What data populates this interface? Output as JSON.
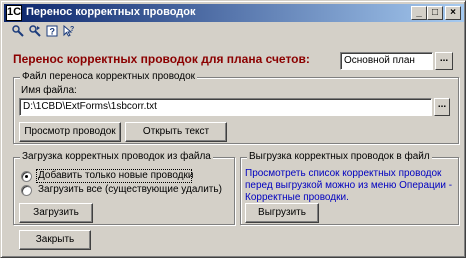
{
  "window": {
    "title": "Перенос корректных проводок",
    "app_icon": "1C",
    "controls": {
      "minimize": "_",
      "maximize": "□",
      "close": "×"
    }
  },
  "toolbar": {
    "icons": [
      "find-icon",
      "find-next-icon",
      "help-icon",
      "help-context-icon"
    ]
  },
  "header": {
    "label": "Перенос корректных проводок для плана счетов:",
    "chart_of_accounts": "Основной план",
    "select_button": "..."
  },
  "file_group": {
    "title": "Файл переноса корректных проводок",
    "file_name_label": "Имя файла:",
    "file_path": "D:\\1CBD\\ExtForms\\1sbcorr.txt",
    "browse_button": "...",
    "view_button": "Просмотр проводок",
    "open_text_button": "Открыть текст"
  },
  "load_group": {
    "title": "Загрузка корректных проводок из файла",
    "option_new": "Добавить только новые проводки",
    "option_all": "Загрузить все (существующие удалить)",
    "selected": "option_new",
    "load_button": "Загрузить"
  },
  "unload_group": {
    "title": "Выгрузка корректных проводок в файл",
    "note": "Просмотреть список корректных проводок перед выгрузкой можно из меню Операции - Корректные проводки.",
    "unload_button": "Выгрузить"
  },
  "footer": {
    "close_button": "Закрыть"
  }
}
